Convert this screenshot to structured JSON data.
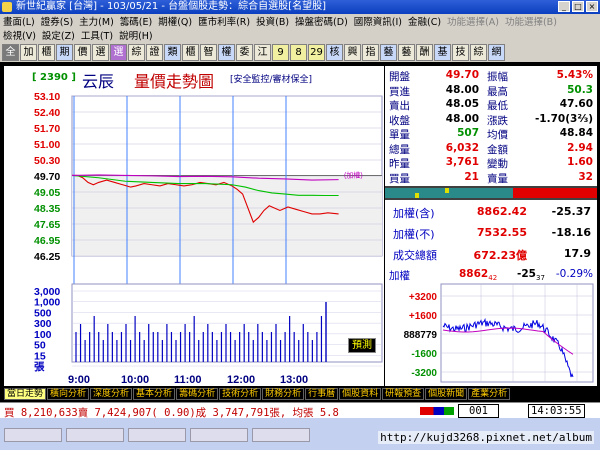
{
  "window": {
    "title": "新世紀贏家 [台灣] - 103/05/21 - 台盤個股走勢：綜合自選股[名望股]",
    "controls": [
      "_",
      "□",
      "×"
    ]
  },
  "menu1": [
    "畫面(L)",
    "證券(S)",
    "主力(M)",
    "籌碼(E)",
    "期權(Q)",
    "匯市利率(R)",
    "投資(B)",
    "操盤密碼(D)",
    "國際資訊(I)",
    "金融(C)",
    "功能選擇(A)",
    "功能選擇(B)"
  ],
  "menu2": [
    "檢視(V)",
    "設定(Z)",
    "工具(T)",
    "說明(H)"
  ],
  "toolbar": [
    "全",
    "加",
    "櫃",
    "期",
    "價",
    "選",
    "選",
    "綜",
    "證",
    "類",
    "櫃",
    "智",
    "權",
    "委",
    "江",
    "9",
    "8",
    "29",
    "核",
    "興",
    "指",
    "藝",
    "藝",
    "酬",
    "基",
    "技",
    "綜",
    "網"
  ],
  "chart": {
    "stock_code": "[ 2390 ]",
    "stock_name": "云辰",
    "title": "量價走勢圖",
    "subtitle": "[安全監控/審材保全]",
    "ref_label": "(加權)",
    "forecast_label": "預測"
  },
  "chart_data": {
    "type": "line",
    "x_labels": [
      "9:00",
      "10:00",
      "11:00",
      "12:00",
      "13:00"
    ],
    "price_ticks": [
      "53.10",
      "52.40",
      "51.70",
      "51.00",
      "50.30",
      "49.70",
      "49.05",
      "48.35",
      "47.65",
      "46.95",
      "46.25"
    ],
    "volume_ticks": [
      "3,000",
      "1,000",
      "500",
      "300",
      "100",
      "50",
      "15",
      "張"
    ],
    "ylim": [
      46.25,
      53.1
    ],
    "reference": 49.7,
    "series": [
      {
        "color": "#e00000",
        "x": [
          0.0,
          0.02,
          0.04,
          0.06,
          0.08,
          0.1,
          0.13,
          0.16,
          0.19,
          0.22,
          0.24,
          0.27,
          0.3,
          0.33,
          0.36,
          0.39,
          0.42,
          0.45,
          0.48,
          0.51,
          0.54,
          0.57,
          0.6,
          0.62,
          0.64,
          0.66,
          0.68,
          0.7,
          0.72,
          0.74,
          0.76,
          0.78,
          0.81,
          0.84,
          0.87,
          0.9,
          0.93,
          0.96,
          1.0
        ],
        "y": [
          49.7,
          49.7,
          49.6,
          49.4,
          49.3,
          49.4,
          49.5,
          49.4,
          49.3,
          49.2,
          49.25,
          49.35,
          49.3,
          49.25,
          49.35,
          49.3,
          49.25,
          49.3,
          49.4,
          49.35,
          49.3,
          49.4,
          49.25,
          49.1,
          48.9,
          48.3,
          47.7,
          47.9,
          48.2,
          48.4,
          48.3,
          48.2,
          48.35,
          48.25,
          48.15,
          48.05,
          48.05,
          48.1,
          48.05
        ]
      },
      {
        "color": "#00c000",
        "x": [
          0.0,
          0.1,
          0.2,
          0.3,
          0.4,
          0.5,
          0.6,
          0.65,
          0.7,
          0.75,
          0.8,
          0.85,
          0.9,
          0.95,
          1.0
        ],
        "y": [
          49.7,
          49.6,
          49.45,
          49.4,
          49.35,
          49.35,
          49.3,
          49.2,
          49.05,
          48.95,
          48.9,
          48.85,
          48.85,
          48.84,
          48.84
        ]
      },
      {
        "color": "#c000c0",
        "x": [
          0.0,
          0.1,
          0.2,
          0.3,
          0.4,
          0.5,
          0.6,
          0.7,
          0.8,
          0.9,
          1.0
        ],
        "y": [
          49.7,
          49.72,
          49.7,
          49.68,
          49.65,
          49.66,
          49.64,
          49.58,
          49.55,
          49.5,
          49.52
        ]
      }
    ],
    "volume": [
      2,
      3,
      1,
      2,
      4,
      2,
      1,
      3,
      2,
      1,
      2,
      3,
      1,
      4,
      2,
      1,
      3,
      2,
      2,
      1,
      3,
      2,
      1,
      2,
      3,
      2,
      4,
      1,
      2,
      3,
      2,
      1,
      2,
      3,
      2,
      1,
      2,
      3,
      2,
      1,
      3,
      2,
      1,
      2,
      3,
      1,
      2,
      4,
      2,
      1,
      3,
      2,
      1,
      2,
      4
    ]
  },
  "quote": {
    "rows": [
      {
        "l1": "開盤",
        "v1": "49.70",
        "c1": "red",
        "l2": "振幅",
        "v2": "5.43%",
        "c2": "red"
      },
      {
        "l1": "買進",
        "v1": "48.00",
        "c1": "blk",
        "l2": "最高",
        "v2": "50.3",
        "c2": "grn"
      },
      {
        "l1": "賣出",
        "v1": "48.05",
        "c1": "blk",
        "l2": "最低",
        "v2": "47.60",
        "c2": "blk"
      },
      {
        "l1": "收盤",
        "v1": "48.00",
        "c1": "blk",
        "l2": "漲跌",
        "v2": "-1.70(3⅔)",
        "c2": "blk"
      },
      {
        "l1": "單量",
        "v1": "507",
        "c1": "grn",
        "l2": "均價",
        "v2": "48.84",
        "c2": "blk"
      },
      {
        "l1": "總量",
        "v1": "6,032",
        "c1": "red",
        "l2": "金額",
        "v2": "2.94",
        "c2": "red"
      },
      {
        "l1": "昨量",
        "v1": "3,761",
        "c1": "red",
        "l2": "變動",
        "v2": "1.60",
        "c2": "red"
      },
      {
        "l1": "買量",
        "v1": "21",
        "c1": "red",
        "l2": "賣量",
        "v2": "32",
        "c2": "red"
      }
    ]
  },
  "rights": {
    "rows": [
      {
        "label": "加權(含)",
        "value": "8862.42",
        "change": "-25.37"
      },
      {
        "label": "加權(不)",
        "value": "7532.55",
        "change": "-18.16"
      },
      {
        "label": "成交總額",
        "value": "672.23億",
        "change": "17.9"
      }
    ]
  },
  "mini": {
    "label": "加權",
    "value": "8862",
    "value_sup": "42",
    "change": "-25",
    "change_sup": "37",
    "pct": "-0.29%",
    "ticks": [
      "+3200",
      "+1600",
      "888779",
      "-1600",
      "-3200"
    ]
  },
  "tabs": [
    "當日走勢",
    "橫向分析",
    "深度分析",
    "基本分析",
    "籌碼分析",
    "技術分析",
    "財務分析",
    "行事曆",
    "個股資料",
    "研報預查",
    "個股新聞",
    "產業分析"
  ],
  "status": {
    "text": "買 8,210,633賣 7,424,907( 0.90)成 3,747,791張, 均張 5.8",
    "code": "001",
    "time": "14:03:55"
  },
  "watermark": "http://kujd3268.pixnet.net/album"
}
